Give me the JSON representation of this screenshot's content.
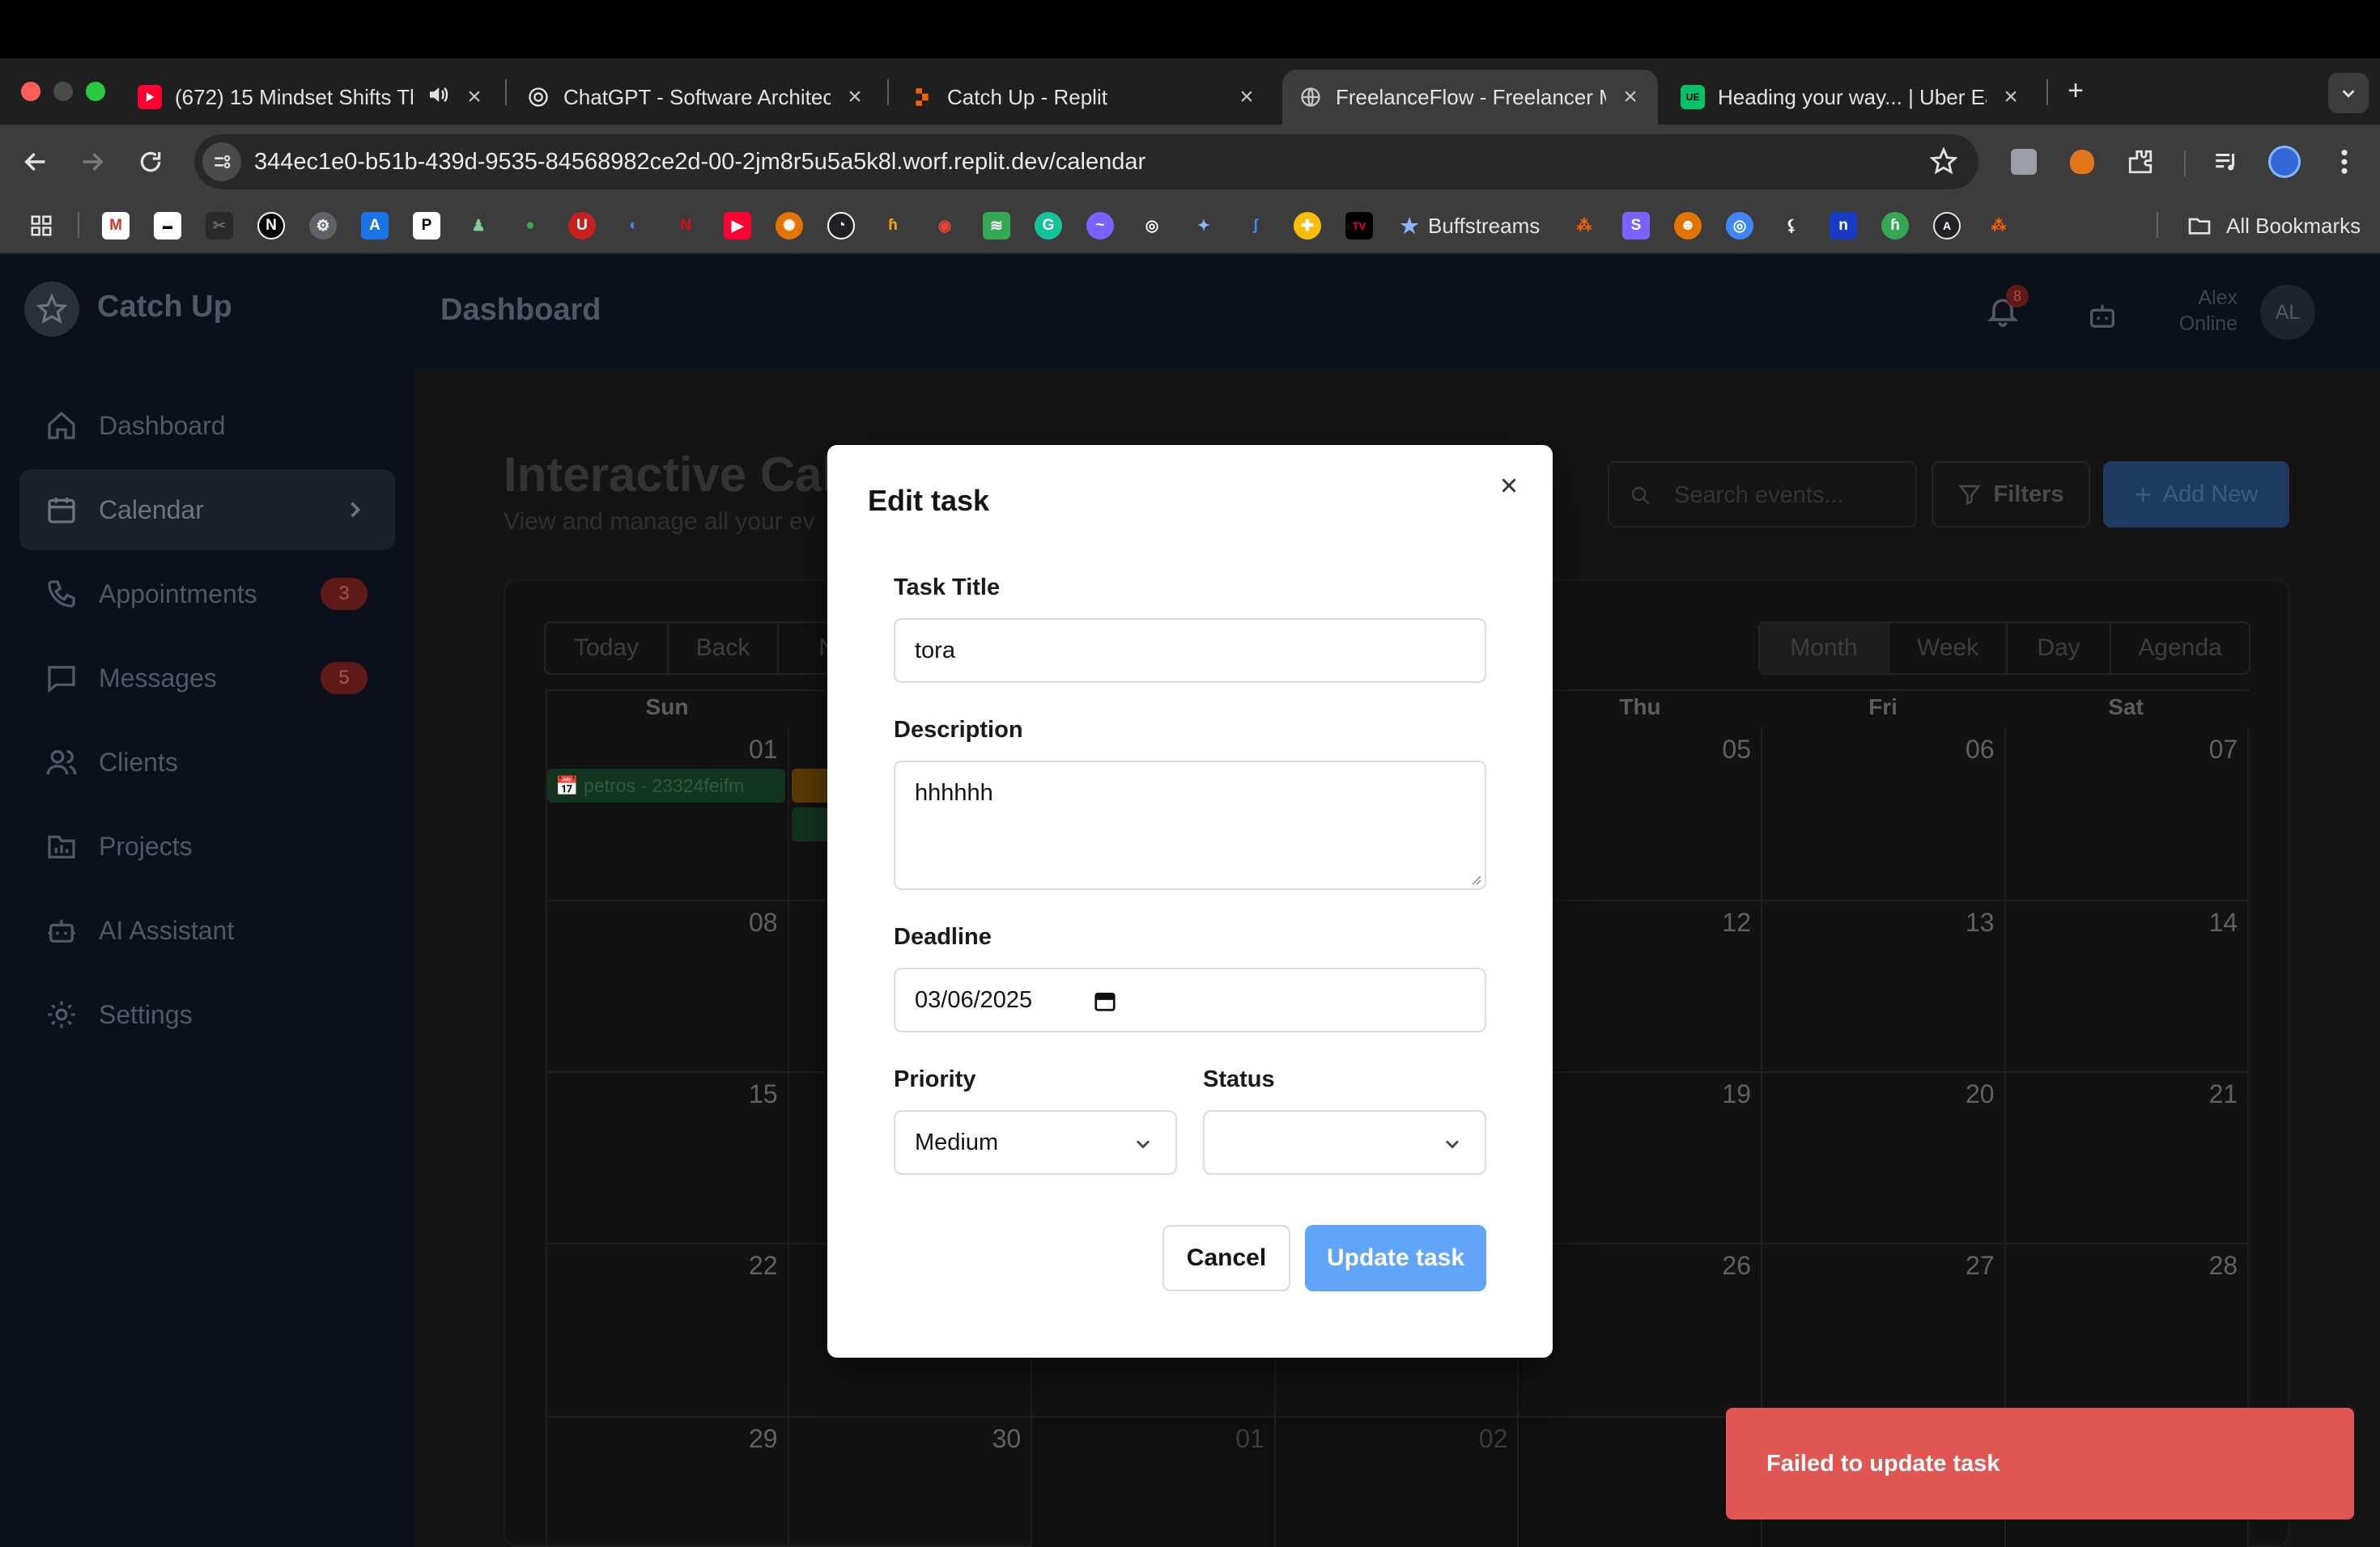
{
  "browser": {
    "tabs": [
      {
        "title": "(672) 15 Mindset Shifts Tha",
        "favicon": "youtube-icon",
        "audio": true
      },
      {
        "title": "ChatGPT - Software Architect",
        "favicon": "chatgpt-icon"
      },
      {
        "title": "Catch Up - Replit",
        "favicon": "replit-icon"
      },
      {
        "title": "FreelanceFlow - Freelancer M",
        "favicon": "globe-icon",
        "active": true
      },
      {
        "title": "Heading your way... | Uber Ea",
        "favicon": "ubereats-icon"
      }
    ],
    "new_tab": "+",
    "url": "344ec1e0-b51b-439d-9535-84568982ce2d-00-2jm8r5u5a5k8l.worf.replit.dev/calendar",
    "bookmarks": {
      "named": "Buffstreams",
      "all_bookmarks": "All Bookmarks"
    }
  },
  "app": {
    "brand": "Catch Up",
    "header_title": "Dashboard",
    "notification_count": "8",
    "user": {
      "name": "Alex",
      "status": "Online",
      "initials": "AL"
    },
    "nav": [
      {
        "label": "Dashboard",
        "icon": "home-icon"
      },
      {
        "label": "Calendar",
        "icon": "calendar-icon",
        "active": true
      },
      {
        "label": "Appointments",
        "icon": "phone-icon",
        "badge": "3"
      },
      {
        "label": "Messages",
        "icon": "message-icon",
        "badge": "5"
      },
      {
        "label": "Clients",
        "icon": "users-icon"
      },
      {
        "label": "Projects",
        "icon": "folder-icon"
      },
      {
        "label": "AI Assistant",
        "icon": "bot-icon"
      },
      {
        "label": "Settings",
        "icon": "gear-icon"
      }
    ]
  },
  "calendar": {
    "title": "Interactive Cal",
    "subtitle": "View and manage all your ev",
    "search_placeholder": "Search events...",
    "filters_label": "Filters",
    "add_new_label": "Add New",
    "nav_buttons": [
      "Today",
      "Back",
      "N"
    ],
    "view_buttons": [
      "Month",
      "Week",
      "Day",
      "Agenda"
    ],
    "active_view": "Month",
    "weekdays": [
      "Sun",
      "",
      "",
      "",
      "Thu",
      "Fri",
      "Sat"
    ],
    "weeks": [
      [
        "01",
        "",
        "",
        "",
        "05",
        "06",
        "07"
      ],
      [
        "08",
        "",
        "",
        "",
        "12",
        "13",
        "14"
      ],
      [
        "15",
        "",
        "",
        "",
        "19",
        "20",
        "21"
      ],
      [
        "22",
        "",
        "",
        "",
        "26",
        "27",
        "28"
      ],
      [
        "29",
        "30",
        "01",
        "02",
        "",
        "",
        ""
      ]
    ],
    "events": [
      {
        "label": "petros - 23324feifm"
      }
    ]
  },
  "modal": {
    "title": "Edit task",
    "task_title_label": "Task Title",
    "task_title_value": "tora",
    "description_label": "Description",
    "description_value": "hhhhhh",
    "deadline_label": "Deadline",
    "deadline_value": "03/06/2025",
    "priority_label": "Priority",
    "priority_value": "Medium",
    "status_label": "Status",
    "status_value": "",
    "cancel_label": "Cancel",
    "update_label": "Update task"
  },
  "toast": {
    "message": "Failed to update task",
    "color": "#e05653"
  },
  "colors": {
    "accent": "#60a5fa",
    "add_new": "#1e3a5f",
    "badge": "#5e1a17"
  }
}
